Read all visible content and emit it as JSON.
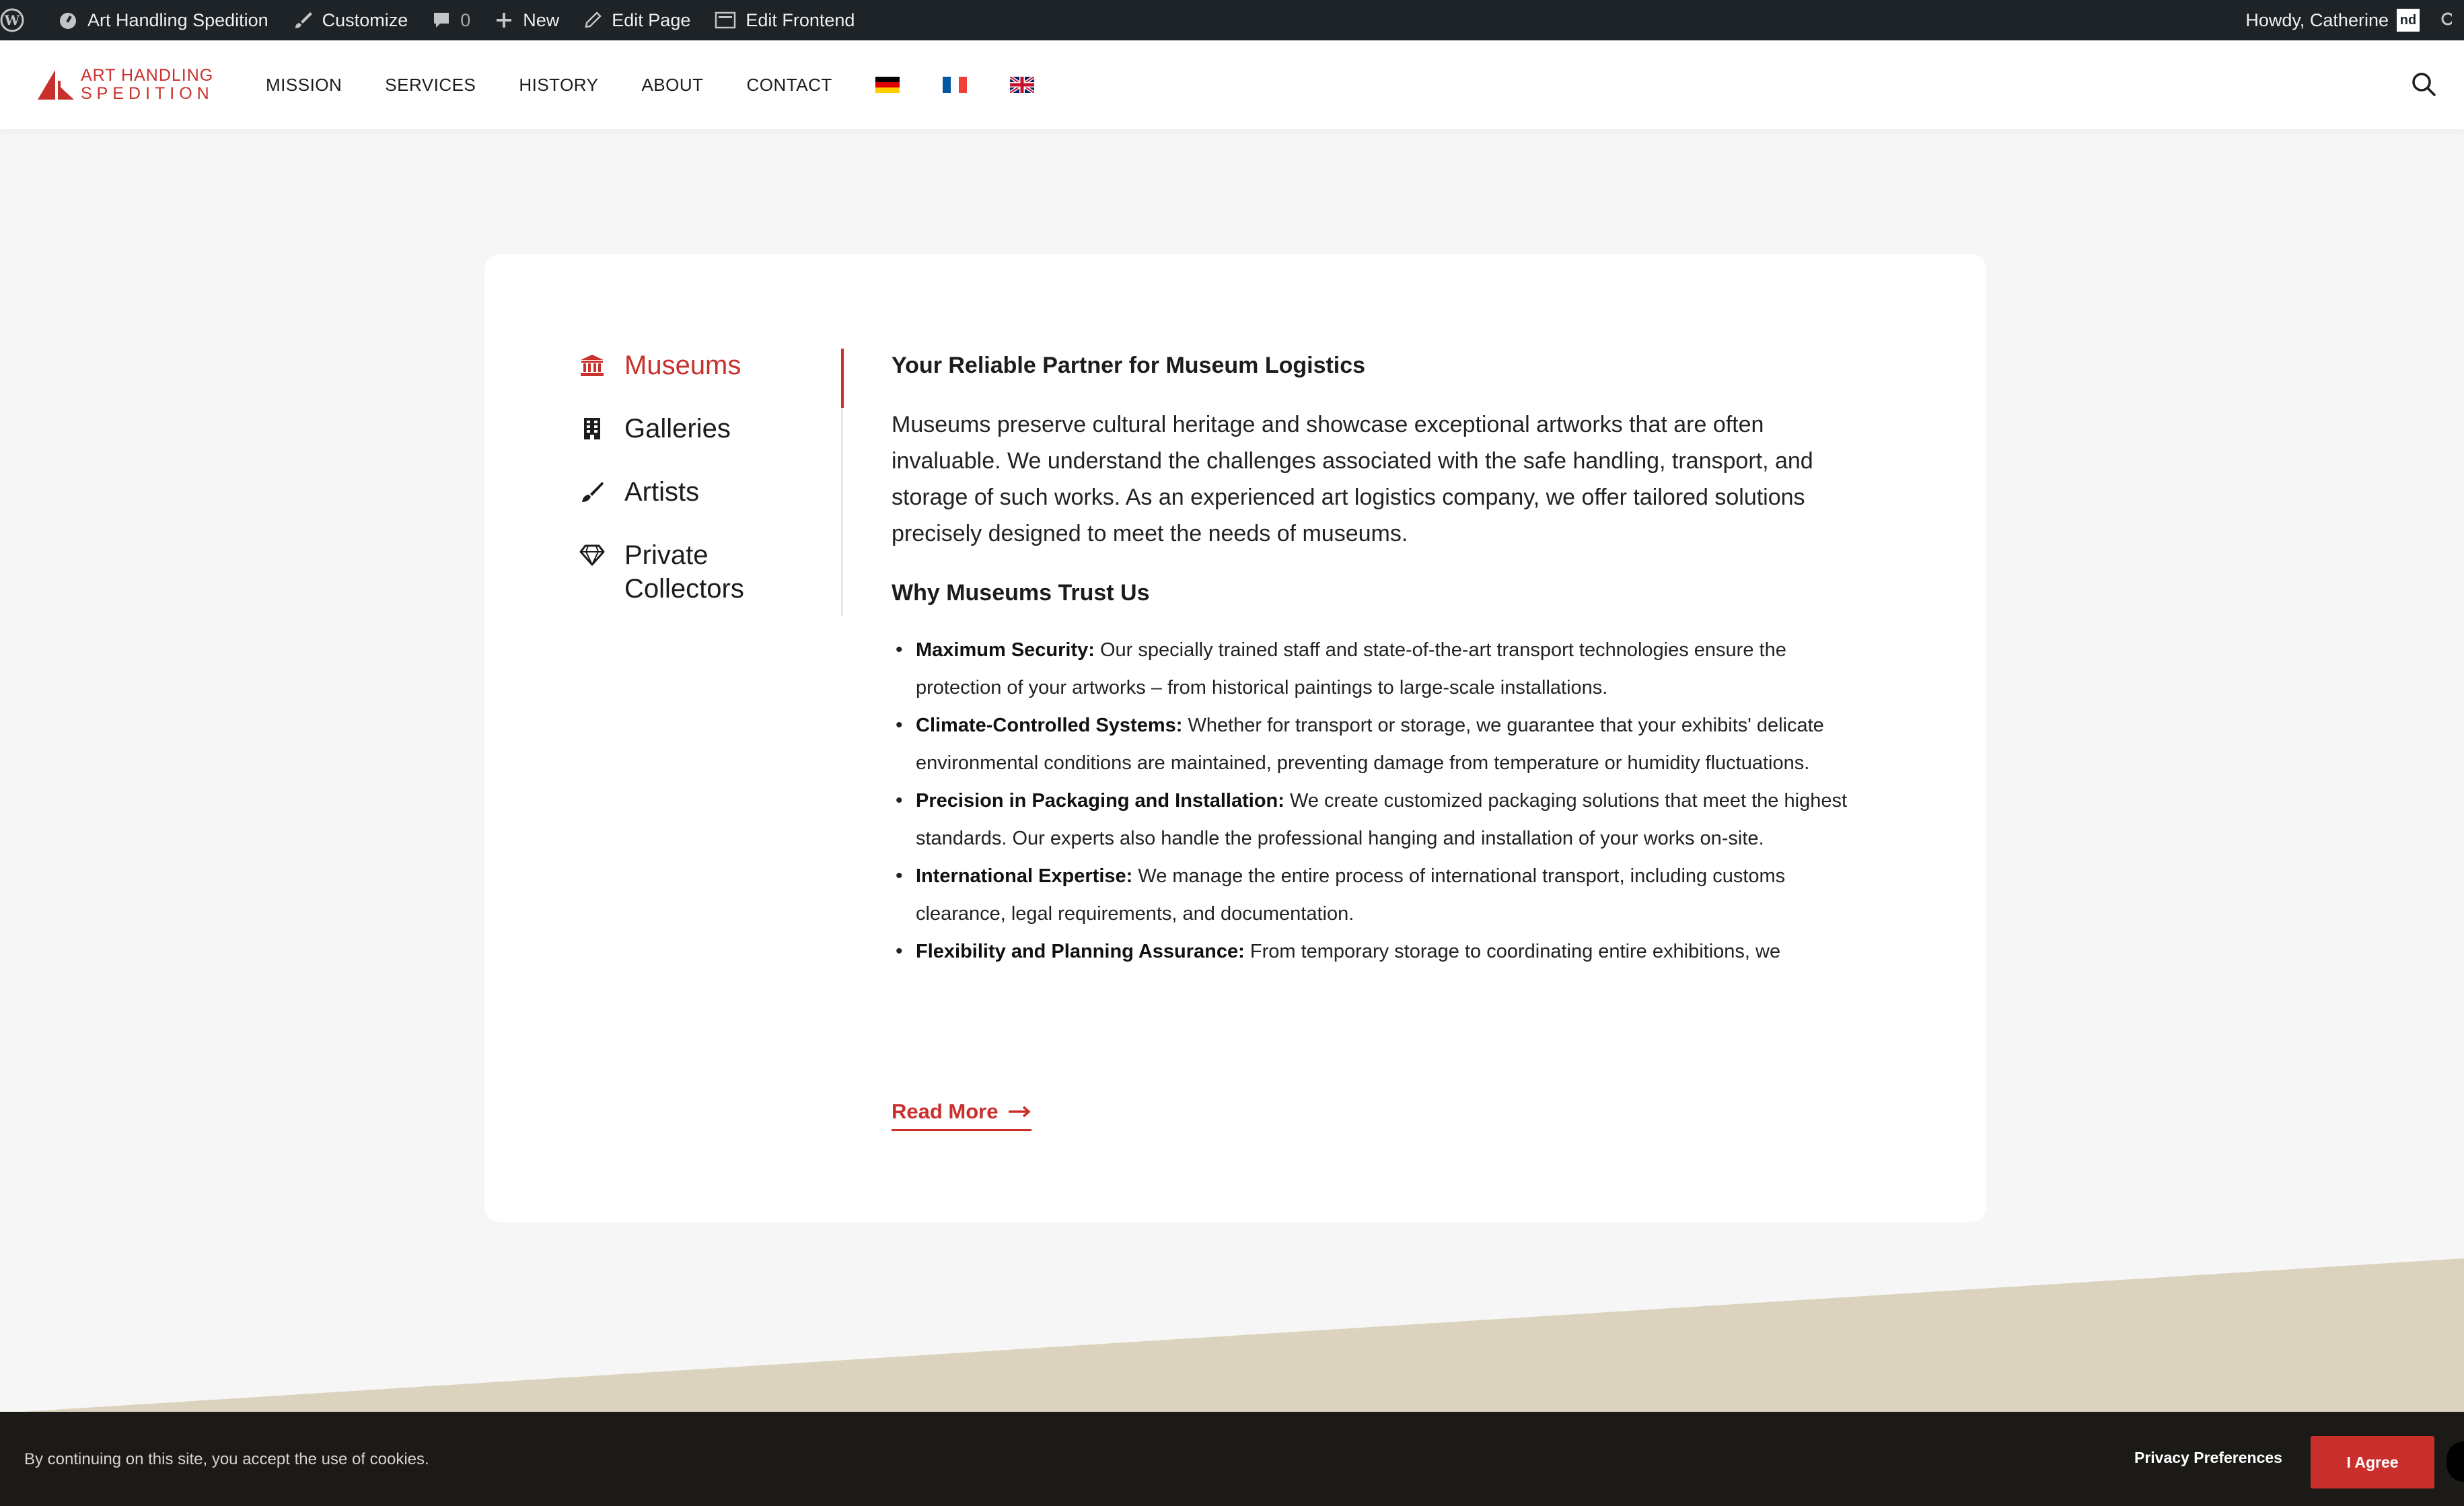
{
  "adminbar": {
    "site_name": "Art Handling Spedition",
    "customize": "Customize",
    "comments_count": "0",
    "new": "New",
    "edit_page": "Edit Page",
    "edit_frontend": "Edit Frontend",
    "howdy": "Howdy, Catherine",
    "avatar_text": "nd"
  },
  "header": {
    "logo_line1": "ART HANDLING",
    "logo_line2": "SPEDITION",
    "nav": [
      "MISSION",
      "SERVICES",
      "HISTORY",
      "ABOUT",
      "CONTACT"
    ],
    "flags": [
      "german-flag",
      "french-flag",
      "uk-flag"
    ]
  },
  "tabs": [
    {
      "label": "Museums",
      "icon": "museum-icon",
      "active": true
    },
    {
      "label": "Galleries",
      "icon": "building-icon",
      "active": false
    },
    {
      "label": "Artists",
      "icon": "paintbrush-icon",
      "active": false
    },
    {
      "label": "Private Collectors",
      "icon": "diamond-icon",
      "active": false
    }
  ],
  "content": {
    "title": "Your Reliable Partner for Museum Logistics",
    "intro": "Museums preserve cultural heritage and showcase exceptional artworks that are often invaluable. We understand the challenges associated with the safe handling, transport, and storage of such works. As an experienced art logistics company, we offer tailored solutions precisely designed to meet the needs of museums.",
    "subtitle": "Why Museums Trust Us",
    "points": [
      {
        "bold": "Maximum Security:",
        "text": " Our specially trained staff and state-of-the-art transport technologies ensure the protection of your artworks – from historical paintings to large-scale installations."
      },
      {
        "bold": "Climate-Controlled Systems:",
        "text": " Whether for transport or storage, we guarantee that your exhibits' delicate environmental conditions are maintained, preventing damage from temperature or humidity fluctuations."
      },
      {
        "bold": "Precision in Packaging and Installation:",
        "text": " We create customized packaging solutions that meet the highest standards. Our experts also handle the professional hanging and installation of your works on-site."
      },
      {
        "bold": "International Expertise:",
        "text": " We manage the entire process of international transport, including customs clearance, legal requirements, and documentation."
      },
      {
        "bold": "Flexibility and Planning Assurance:",
        "text": " From temporary storage to coordinating entire exhibitions, we"
      }
    ],
    "read_more": "Read More"
  },
  "cookie": {
    "text": "By continuing on this site, you accept the use of cookies.",
    "privacy": "Privacy Preferences",
    "agree": "I Agree"
  },
  "colors": {
    "accent": "#c9302c",
    "adminbar": "#1d2327",
    "beige": "#dbd3bd",
    "cookiebar": "#1c1a17"
  }
}
